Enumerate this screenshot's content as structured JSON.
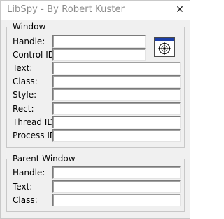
{
  "window": {
    "title": "LibSpy - By Robert Kuster",
    "close_glyph": "✕"
  },
  "window_group": {
    "legend": "Window",
    "labels": {
      "handle": "Handle:",
      "control_id": "Control ID:",
      "text": "Text:",
      "class": "Class:",
      "style": "Style:",
      "rect": "Rect:",
      "thread_id": "Thread ID:",
      "process_id": "Process ID:"
    },
    "values": {
      "handle": "",
      "control_id": "",
      "text": "",
      "class": "",
      "style": "",
      "rect": "",
      "thread_id": "",
      "process_id": ""
    },
    "finder_tool_icon": "crosshair-finder-icon"
  },
  "parent_group": {
    "legend": "Parent Window",
    "labels": {
      "handle": "Handle:",
      "text": "Text:",
      "class": "Class:"
    },
    "values": {
      "handle": "",
      "text": "",
      "class": ""
    }
  },
  "colors": {
    "finder_bar": "#1c3fa8",
    "title_text": "#8a8a8a",
    "group_border": "#c8c8c8"
  }
}
